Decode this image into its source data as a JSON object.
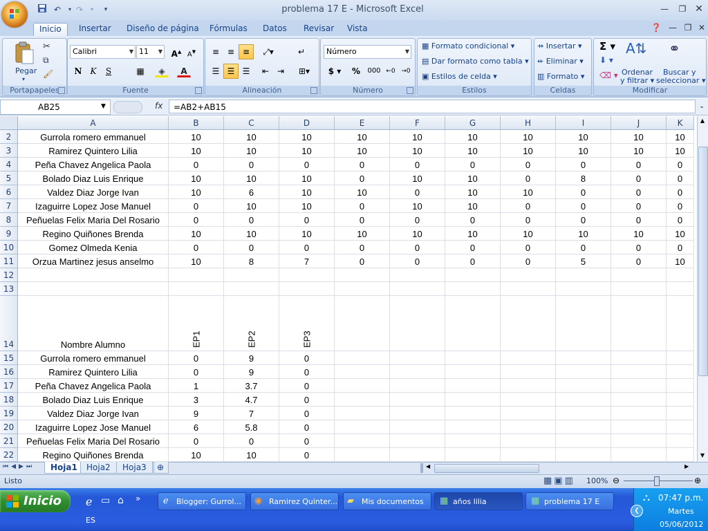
{
  "window": {
    "title": "problema 17 E - Microsoft Excel"
  },
  "ribbon": {
    "tabs": [
      "Inicio",
      "Insertar",
      "Diseño de página",
      "Fórmulas",
      "Datos",
      "Revisar",
      "Vista"
    ],
    "portapapeles": {
      "label": "Portapapeles",
      "paste": "Pegar"
    },
    "fuente": {
      "label": "Fuente",
      "font": "Calibri",
      "size": "11"
    },
    "alineacion": {
      "label": "Alineación"
    },
    "numero": {
      "label": "Número",
      "format": "Número",
      "pct": "%",
      "thousand": "000"
    },
    "estilos": {
      "label": "Estilos",
      "cond": "Formato condicional",
      "table": "Dar formato como tabla",
      "cell": "Estilos de celda"
    },
    "celdas": {
      "label": "Celdas",
      "insert": "Insertar",
      "delete": "Eliminar",
      "format": "Formato"
    },
    "modificar": {
      "label": "Modificar",
      "sort1": "Ordenar",
      "sort2": "y filtrar",
      "find1": "Buscar y",
      "find2": "seleccionar"
    }
  },
  "formula_bar": {
    "name_box": "AB25",
    "fx": "fx",
    "formula": "=AB2+AB15"
  },
  "grid": {
    "columns": [
      "A",
      "B",
      "C",
      "D",
      "E",
      "F",
      "G",
      "H",
      "I",
      "J",
      "K"
    ],
    "rows": [
      {
        "n": "2",
        "cells": [
          "Gurrola romero emmanuel",
          "10",
          "10",
          "10",
          "10",
          "10",
          "10",
          "10",
          "10",
          "10",
          "10"
        ]
      },
      {
        "n": "3",
        "cells": [
          "Ramirez Quintero Lilia",
          "10",
          "10",
          "10",
          "10",
          "10",
          "10",
          "10",
          "10",
          "10",
          "10"
        ]
      },
      {
        "n": "4",
        "cells": [
          "Peña Chavez Angelica Paola",
          "0",
          "0",
          "0",
          "0",
          "0",
          "0",
          "0",
          "0",
          "0",
          "0"
        ]
      },
      {
        "n": "5",
        "cells": [
          "Bolado Diaz Luis Enrique",
          "10",
          "10",
          "10",
          "0",
          "10",
          "10",
          "0",
          "8",
          "0",
          "0"
        ]
      },
      {
        "n": "6",
        "cells": [
          "Valdez Diaz Jorge Ivan",
          "10",
          "6",
          "10",
          "10",
          "0",
          "10",
          "10",
          "0",
          "0",
          "0"
        ]
      },
      {
        "n": "7",
        "cells": [
          "Izaguirre Lopez Jose Manuel",
          "0",
          "10",
          "10",
          "0",
          "10",
          "10",
          "0",
          "0",
          "0",
          "0"
        ]
      },
      {
        "n": "8",
        "cells": [
          "Peñuelas Felix Maria Del Rosario",
          "0",
          "0",
          "0",
          "0",
          "0",
          "0",
          "0",
          "0",
          "0",
          "0"
        ]
      },
      {
        "n": "9",
        "cells": [
          "Regino Quiñones Brenda",
          "10",
          "10",
          "10",
          "10",
          "10",
          "10",
          "10",
          "10",
          "10",
          "10"
        ]
      },
      {
        "n": "10",
        "cells": [
          "Gomez Olmeda Kenia",
          "0",
          "0",
          "0",
          "0",
          "0",
          "0",
          "0",
          "0",
          "0",
          "0"
        ]
      },
      {
        "n": "11",
        "cells": [
          "Orzua Martinez jesus anselmo",
          "10",
          "8",
          "7",
          "0",
          "0",
          "0",
          "0",
          "5",
          "0",
          "10"
        ]
      },
      {
        "n": "12",
        "cells": [
          "",
          "",
          "",
          "",
          "",
          "",
          "",
          "",
          "",
          "",
          ""
        ]
      },
      {
        "n": "13",
        "cells": [
          "",
          "",
          "",
          "",
          "",
          "",
          "",
          "",
          "",
          "",
          ""
        ]
      },
      {
        "n": "14",
        "cells": [
          "Nombre Alumno",
          "EP1",
          "EP2",
          "EP3",
          "",
          "",
          "",
          "",
          "",
          "",
          ""
        ]
      },
      {
        "n": "15",
        "cells": [
          "Gurrola romero emmanuel",
          "0",
          "9",
          "0",
          "",
          "",
          "",
          "",
          "",
          "",
          ""
        ]
      },
      {
        "n": "16",
        "cells": [
          "Ramirez Quintero Lilia",
          "0",
          "9",
          "0",
          "",
          "",
          "",
          "",
          "",
          "",
          ""
        ]
      },
      {
        "n": "17",
        "cells": [
          "Peña Chavez Angelica Paola",
          "1",
          "3.7",
          "0",
          "",
          "",
          "",
          "",
          "",
          "",
          ""
        ]
      },
      {
        "n": "18",
        "cells": [
          "Bolado Diaz Luis Enrique",
          "3",
          "4.7",
          "0",
          "",
          "",
          "",
          "",
          "",
          "",
          ""
        ]
      },
      {
        "n": "19",
        "cells": [
          "Valdez Diaz Jorge Ivan",
          "9",
          "7",
          "0",
          "",
          "",
          "",
          "",
          "",
          "",
          ""
        ]
      },
      {
        "n": "20",
        "cells": [
          "Izaguirre Lopez Jose Manuel",
          "6",
          "5.8",
          "0",
          "",
          "",
          "",
          "",
          "",
          "",
          ""
        ]
      },
      {
        "n": "21",
        "cells": [
          "Peñuelas Felix Maria Del Rosario",
          "0",
          "0",
          "0",
          "",
          "",
          "",
          "",
          "",
          "",
          ""
        ]
      },
      {
        "n": "22",
        "cells": [
          "Regino Quiñones Brenda",
          "10",
          "10",
          "0",
          "",
          "",
          "",
          "",
          "",
          "",
          ""
        ]
      }
    ]
  },
  "sheets": {
    "tabs": [
      "Hoja1",
      "Hoja2",
      "Hoja3"
    ],
    "active": "Hoja1"
  },
  "status": {
    "text": "Listo",
    "zoom": "100%"
  },
  "taskbar": {
    "start": "Inicio",
    "tasks": [
      "Blogger: Gurrol...",
      "Ramirez Quinter...",
      "Mis documentos",
      "años lilia",
      "problema 17 E"
    ],
    "active_task": "años lilia",
    "lang": "ES",
    "time": "07:47 p.m.",
    "day": "Martes",
    "date": "05/06/2012"
  }
}
